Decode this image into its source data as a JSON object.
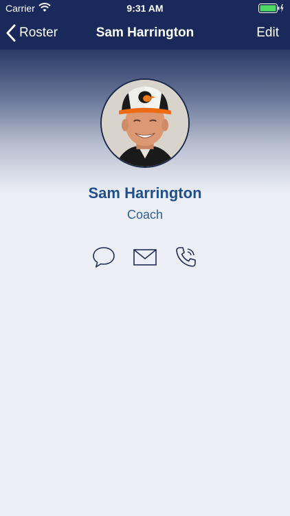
{
  "status_bar": {
    "carrier": "Carrier",
    "time": "9:31 AM",
    "battery_color": "#4CD964"
  },
  "nav": {
    "back_label": "Roster",
    "title": "Sam Harrington",
    "edit_label": "Edit",
    "bar_color": "#18295A"
  },
  "profile": {
    "name": "Sam Harrington",
    "role": "Coach",
    "name_color": "#1E4F8F"
  },
  "actions": {
    "icons": [
      "message-icon",
      "mail-icon",
      "phone-icon"
    ]
  }
}
